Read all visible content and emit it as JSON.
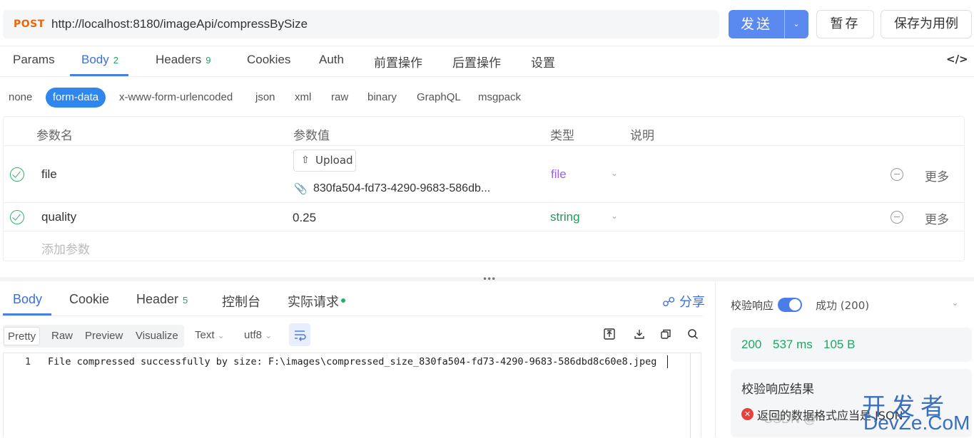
{
  "request": {
    "method": "POST",
    "url": "http://localhost:8180/imageApi/compressBySize",
    "send_label": "发送",
    "save_label": "暂存",
    "save_as_label": "保存为用例"
  },
  "tabs": [
    {
      "label": "Params"
    },
    {
      "label": "Body",
      "count": "2"
    },
    {
      "label": "Headers",
      "count": "9"
    },
    {
      "label": "Cookies"
    },
    {
      "label": "Auth"
    },
    {
      "label": "前置操作"
    },
    {
      "label": "后置操作"
    },
    {
      "label": "设置"
    }
  ],
  "body_types": [
    "none",
    "form-data",
    "x-www-form-urlencoded",
    "json",
    "xml",
    "raw",
    "binary",
    "GraphQL",
    "msgpack"
  ],
  "params_table": {
    "headers": [
      "参数名",
      "参数值",
      "类型",
      "说明"
    ],
    "rows": [
      {
        "name": "file",
        "upload_label": "Upload",
        "filename": "830fa504-fd73-4290-9683-586db...",
        "type": "file",
        "more": "更多"
      },
      {
        "name": "quality",
        "value": "0.25",
        "type": "string",
        "more": "更多"
      }
    ],
    "add_placeholder": "添加参数"
  },
  "response": {
    "tabs": [
      {
        "label": "Body"
      },
      {
        "label": "Cookie"
      },
      {
        "label": "Header",
        "count": "5"
      },
      {
        "label": "控制台"
      },
      {
        "label": "实际请求"
      }
    ],
    "share_label": "分享",
    "view_modes": [
      "Pretty",
      "Raw",
      "Preview",
      "Visualize"
    ],
    "format_select": "Text",
    "encoding_select": "utf8",
    "line_number": "1",
    "content": "File compressed successfully by size: F:\\images\\compressed_size_830fa504-fd73-4290-9683-586dbd8c60e8.jpeg"
  },
  "verify": {
    "label": "校验响应",
    "status": "成功 (200)",
    "status_code": "200",
    "time": "537 ms",
    "size": "105 B",
    "result_title": "校验响应结果",
    "error_text": "返回的数据格式应当是 JSON"
  },
  "watermark": {
    "csdn": "CSDN @",
    "line1": "开发者",
    "line2": "DevZe.CoM"
  },
  "colors": {
    "accent": "#4a7de8",
    "send_button": "#5a8af0",
    "method": "#e8660c",
    "success": "#22a464",
    "file_type": "#9564e6",
    "error": "#e8403b"
  }
}
